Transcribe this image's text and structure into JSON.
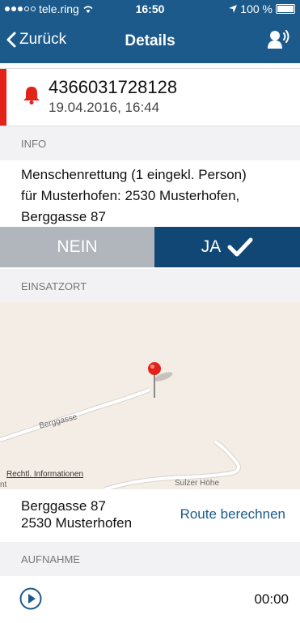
{
  "status_bar": {
    "carrier": "tele.ring",
    "time": "16:50",
    "battery": "100 %"
  },
  "nav": {
    "back_label": "Zurück",
    "title": "Details",
    "speaker_icon": "speaker-icon"
  },
  "alarm": {
    "number": "4366031728128",
    "datetime": "19.04.2016, 16:44",
    "accent_color": "#e2231a"
  },
  "info": {
    "header": "INFO",
    "line1": "Menschenrettung (1 eingekl. Person)",
    "line2": "für Musterhofen: 2530 Musterhofen,",
    "line3": "Berggasse 87"
  },
  "response": {
    "no_label": "NEIN",
    "yes_label": "JA"
  },
  "location": {
    "header": "EINSATZORT",
    "map_street_1": "Berggasse",
    "map_street_2": "Sulzer Höhe",
    "map_fragment": "nt",
    "legal_link": "Rechtl. Informationen",
    "address_line1": "Berggasse 87",
    "address_line2": "2530 Musterhofen",
    "route_label": "Route berechnen"
  },
  "recording": {
    "header": "AUFNAHME",
    "time": "00:00"
  },
  "colors": {
    "nav_bg": "#1b5a8a",
    "yes_bg": "#114775",
    "no_bg": "#b0b6bc"
  }
}
